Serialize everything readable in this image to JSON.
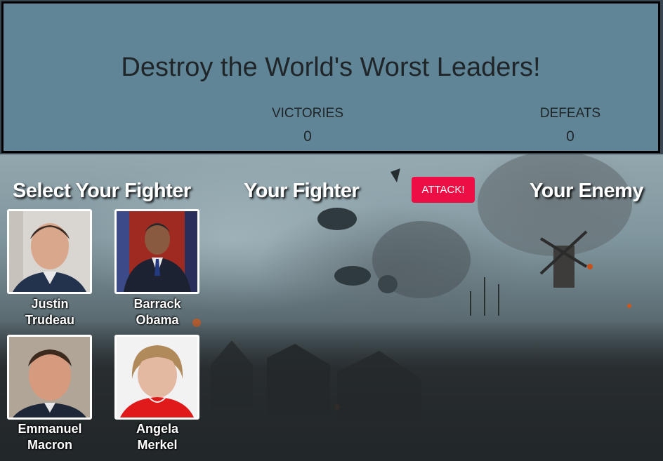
{
  "header": {
    "title": "Destroy the World's Worst Leaders!",
    "victories_label": "VICTORIES",
    "victories_value": "0",
    "defeats_label": "DEFEATS",
    "defeats_value": "0"
  },
  "arena": {
    "select_heading": "Select Your Fighter",
    "fighter_heading": "Your Fighter",
    "enemy_heading": "Your Enemy",
    "attack_label": "ATTACK!"
  },
  "fighters": [
    {
      "name_line1": "Justin",
      "name_line2": "Trudeau"
    },
    {
      "name_line1": "Barrack",
      "name_line2": "Obama"
    },
    {
      "name_line1": "Emmanuel",
      "name_line2": "Macron"
    },
    {
      "name_line1": "Angela",
      "name_line2": "Merkel"
    }
  ],
  "colors": {
    "header_bg": "#5f8596",
    "attack_button": "#ec0e45"
  }
}
